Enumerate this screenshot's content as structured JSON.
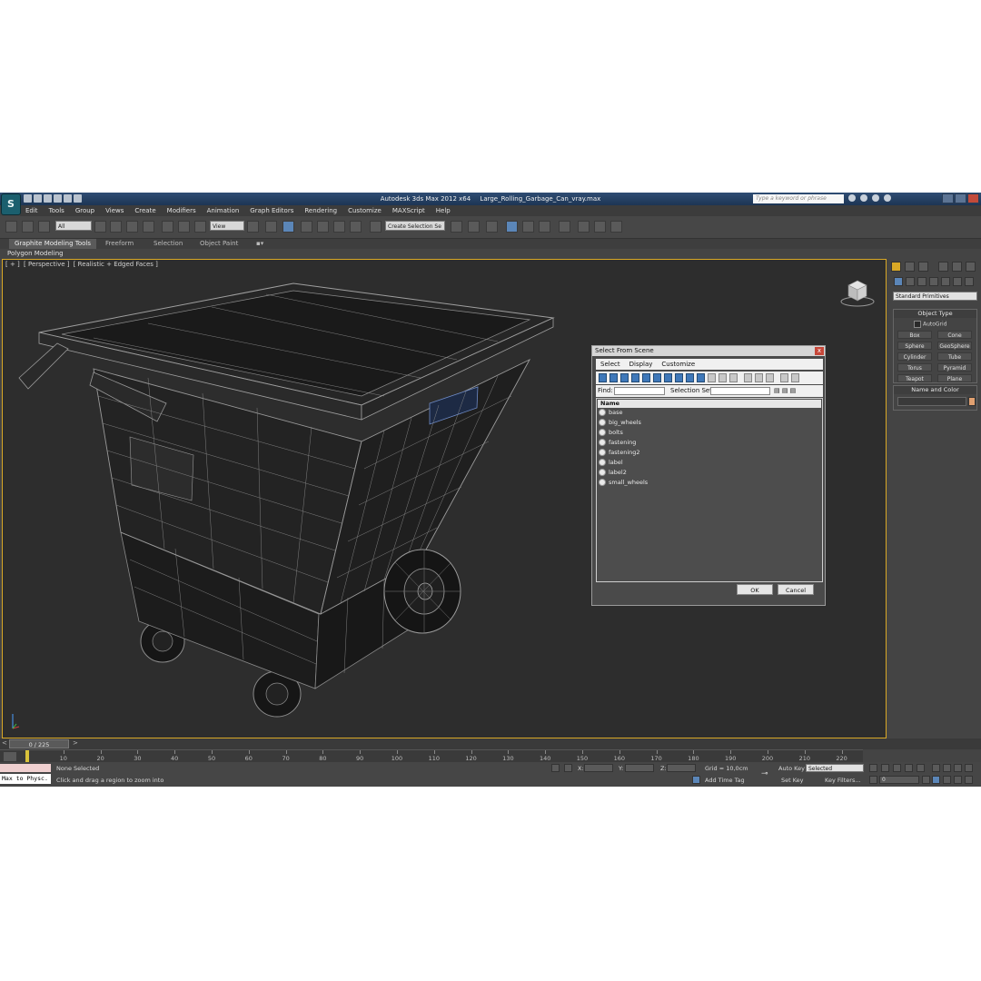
{
  "titlebar": {
    "app": "Autodesk 3ds Max  2012 x64",
    "file": "Large_Rolling_Garbage_Can_vray.max",
    "search_placeholder": "Type a keyword or phrase"
  },
  "menu": [
    "Edit",
    "Tools",
    "Group",
    "Views",
    "Create",
    "Modifiers",
    "Animation",
    "Graph Editors",
    "Rendering",
    "Customize",
    "MAXScript",
    "Help"
  ],
  "toolbar": {
    "selection_filter": "All",
    "ref_coord": "View",
    "named_selection": "Create Selection Se"
  },
  "ribbon": {
    "tabs": [
      "Graphite Modeling Tools",
      "Freeform",
      "Selection",
      "Object Paint"
    ],
    "panel": "Polygon Modeling"
  },
  "viewport": {
    "labels": [
      "[ + ]",
      "[ Perspective ]",
      "[ Realistic + Edged Faces ]"
    ]
  },
  "dialog": {
    "title": "Select From Scene",
    "close": "x",
    "menu": [
      "Select",
      "Display",
      "Customize"
    ],
    "find_label": "Find:",
    "selection_set_label": "Selection Set:",
    "column": "Name",
    "items": [
      "base",
      "big_wheels",
      "bolts",
      "fastening",
      "fastening2",
      "label",
      "label2",
      "small_wheels"
    ],
    "ok": "OK",
    "cancel": "Cancel"
  },
  "command_panel": {
    "category": "Standard Primitives",
    "object_type_title": "Object Type",
    "autogrid": "AutoGrid",
    "primitives": [
      "Box",
      "Cone",
      "Sphere",
      "GeoSphere",
      "Cylinder",
      "Tube",
      "Torus",
      "Pyramid",
      "Teapot",
      "Plane"
    ],
    "name_color_title": "Name and Color",
    "swatch_color": "#e0a070"
  },
  "timeline": {
    "frame": "0 / 225",
    "ticks": [
      "10",
      "20",
      "30",
      "40",
      "50",
      "60",
      "70",
      "80",
      "90",
      "100",
      "110",
      "120",
      "130",
      "140",
      "150",
      "160",
      "170",
      "180",
      "190",
      "200",
      "210",
      "220"
    ]
  },
  "status": {
    "maxscript": "Max to Physc.",
    "selected": "None Selected",
    "prompt": "Click and drag a region to zoom into",
    "x": "X:",
    "y": "Y:",
    "z": "Z:",
    "grid": "Grid = 10,0cm",
    "add_time_tag": "Add Time Tag",
    "auto_key": "Auto Key",
    "set_key": "Set Key",
    "key_mode": "Selected",
    "key_filters": "Key Filters...",
    "current_frame": "0"
  },
  "colors": {
    "active_viewport_border": "#d9a826",
    "title_bar": "#2f4d73",
    "highlight": "#5b86b8"
  }
}
